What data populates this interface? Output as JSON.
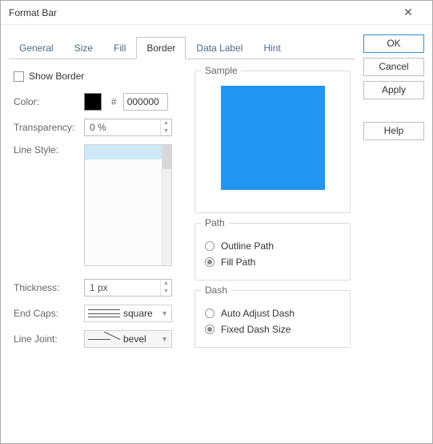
{
  "window": {
    "title": "Format Bar"
  },
  "tabs": {
    "items": [
      {
        "label": "General"
      },
      {
        "label": "Size"
      },
      {
        "label": "Fill"
      },
      {
        "label": "Border"
      },
      {
        "label": "Data Label"
      },
      {
        "label": "Hint"
      }
    ],
    "active": "Border"
  },
  "border": {
    "show_border_label": "Show Border",
    "show_border_checked": false,
    "color_label": "Color:",
    "color_hex": "000000",
    "color_swatch": "#000000",
    "transparency_label": "Transparency:",
    "transparency_value": "0 %",
    "line_style_label": "Line Style:",
    "thickness_label": "Thickness:",
    "thickness_value": "1 px",
    "end_caps_label": "End Caps:",
    "end_caps_value": "square",
    "line_joint_label": "Line Joint:",
    "line_joint_value": "bevel"
  },
  "sample": {
    "legend": "Sample",
    "color": "#2a91ea"
  },
  "path": {
    "legend": "Path",
    "outline_label": "Outline Path",
    "fill_label": "Fill Path",
    "selected": "fill"
  },
  "dash": {
    "legend": "Dash",
    "auto_label": "Auto Adjust Dash",
    "fixed_label": "Fixed Dash Size",
    "selected": "fixed"
  },
  "buttons": {
    "ok": "OK",
    "cancel": "Cancel",
    "apply": "Apply",
    "help": "Help"
  }
}
